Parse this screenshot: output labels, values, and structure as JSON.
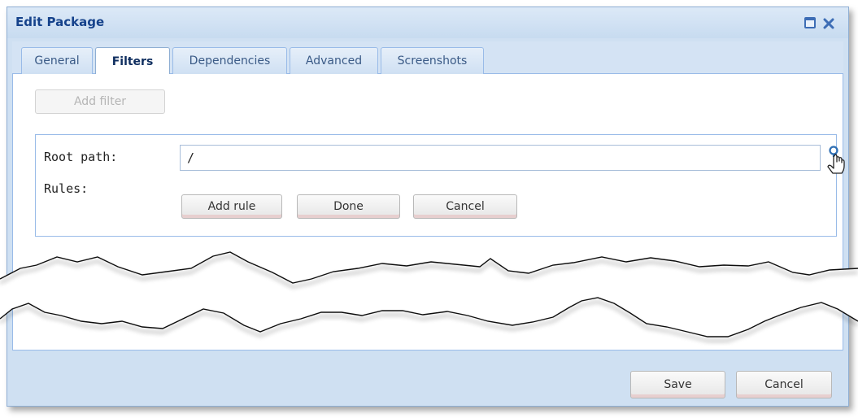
{
  "window": {
    "title": "Edit Package",
    "controls": {
      "maximize_icon": "maximize-icon",
      "close_icon": "close-icon"
    }
  },
  "tabs": [
    {
      "label": "General",
      "active": false
    },
    {
      "label": "Filters",
      "active": true
    },
    {
      "label": "Dependencies",
      "active": false
    },
    {
      "label": "Advanced",
      "active": false
    },
    {
      "label": "Screenshots",
      "active": false
    }
  ],
  "filters": {
    "add_filter_label": "Add filter",
    "root_path_label": "Root path:",
    "root_path_value": "/",
    "rules_label": "Rules:",
    "add_rule_label": "Add rule",
    "done_label": "Done",
    "cancel_label": "Cancel",
    "browse_icon": "search-icon"
  },
  "footer": {
    "save_label": "Save",
    "cancel_label": "Cancel"
  },
  "colors": {
    "title": "#15428b",
    "window_bg": "#cfe0f2",
    "border": "#99bbe8"
  }
}
